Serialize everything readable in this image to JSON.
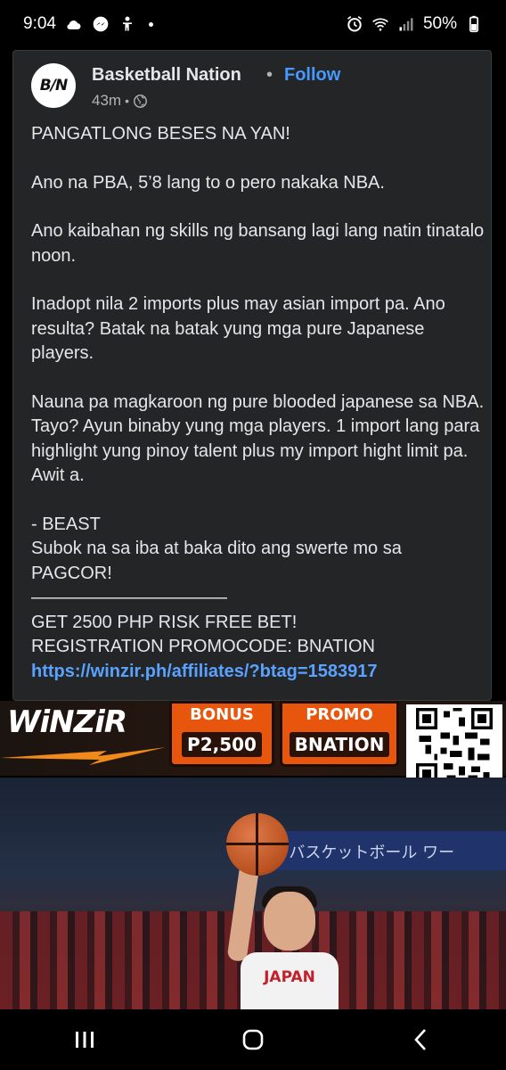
{
  "status_bar": {
    "time": "9:04",
    "battery": "50%",
    "left_icons": [
      "cloud-icon",
      "messenger-icon",
      "accessibility-icon",
      "dot-icon"
    ],
    "right_icons": [
      "alarm-icon",
      "wifi-icon",
      "signal-icon",
      "battery-icon"
    ]
  },
  "post": {
    "page_name": "Basketball Nation",
    "avatar_text": "B/N",
    "separator": "•",
    "follow_label": "Follow",
    "time_ago": "43m",
    "meta_separator": "•",
    "paragraphs": [
      "PANGATLONG BESES NA YAN!",
      "Ano na PBA, 5’8 lang to o pero nakaka NBA.",
      "Ano kaibahan ng skills ng bansang lagi lang natin tinatalo noon.",
      "Inadopt nila 2 imports plus may asian import pa. Ano resulta? Batak na batak yung mga pure Japanese players.",
      "Nauna pa magkaroon ng pure blooded japanese sa NBA. Tayo? Ayun binaby yung mga players. 1 import lang para highlight yung pinoy talent plus my import hight limit pa. Awit a."
    ],
    "signature_lines": [
      "- BEAST",
      "Subok na sa iba at baka dito ang swerte mo sa PAGCOR!",
      "———————————",
      "GET 2500 PHP RISK FREE BET!",
      "REGISTRATION PROMOCODE: BNATION"
    ],
    "link": "https://winzir.ph/affiliates/?btag=1583917"
  },
  "banner": {
    "brand": "WiNZiR",
    "bonus_label": "BONUS",
    "bonus_value": "P2,500",
    "promo_label": "PROMO",
    "promo_value": "BNATION"
  },
  "photo": {
    "board_text": "BA バスケットボール ワー",
    "jersey_text": "JAPAN"
  },
  "nav": {
    "icons": [
      "recent-apps-icon",
      "home-icon",
      "back-icon"
    ]
  },
  "colors": {
    "card_bg": "#242526",
    "link": "#5aa2ff",
    "follow": "#4599ff",
    "banner_orange": "#e8560e"
  }
}
